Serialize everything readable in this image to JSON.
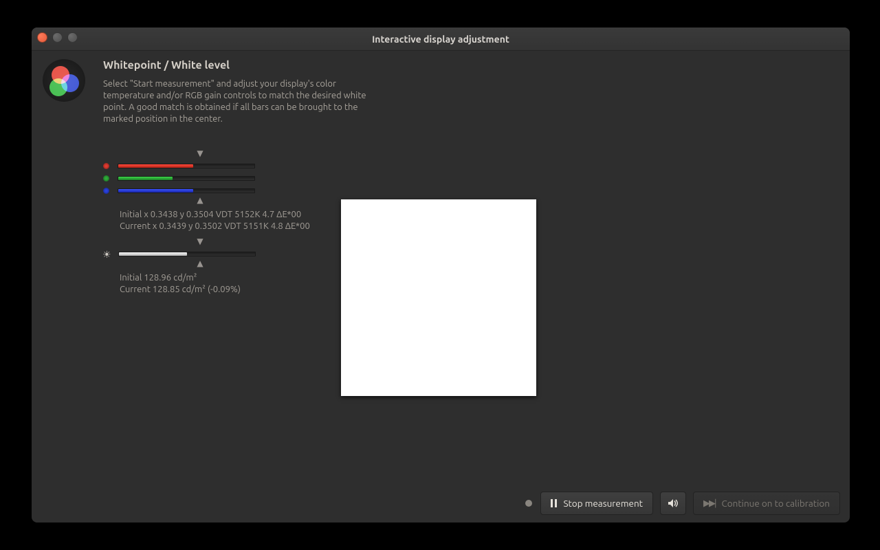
{
  "window": {
    "title": "Interactive display adjustment"
  },
  "section": {
    "heading": "Whitepoint / White level",
    "description": "Select \"Start measurement\" and adjust your display's color temperature and/or RGB gain controls to match the desired white point. A good match is obtained if all bars can be brought to the marked position in the center."
  },
  "rgb": {
    "marker_top": "▼",
    "marker_bottom": "▲",
    "red_pct": 55,
    "green_pct": 40,
    "blue_pct": 55,
    "initial_line": "Initial x 0.3438 y 0.3504 VDT 5152K 4.7 ΔE*00",
    "current_line": "Current x 0.3439 y 0.3502 VDT 5151K 4.8 ΔE*00"
  },
  "luminance": {
    "marker_top": "▼",
    "marker_bottom": "▲",
    "white_pct": 50,
    "initial_line": "Initial 128.96 cd/m²",
    "current_line": "Current 128.85 cd/m² (-0.09%)"
  },
  "patch_color": "#ffffff",
  "footer": {
    "stop_label": "Stop measurement",
    "continue_label": "Continue on to calibration"
  }
}
